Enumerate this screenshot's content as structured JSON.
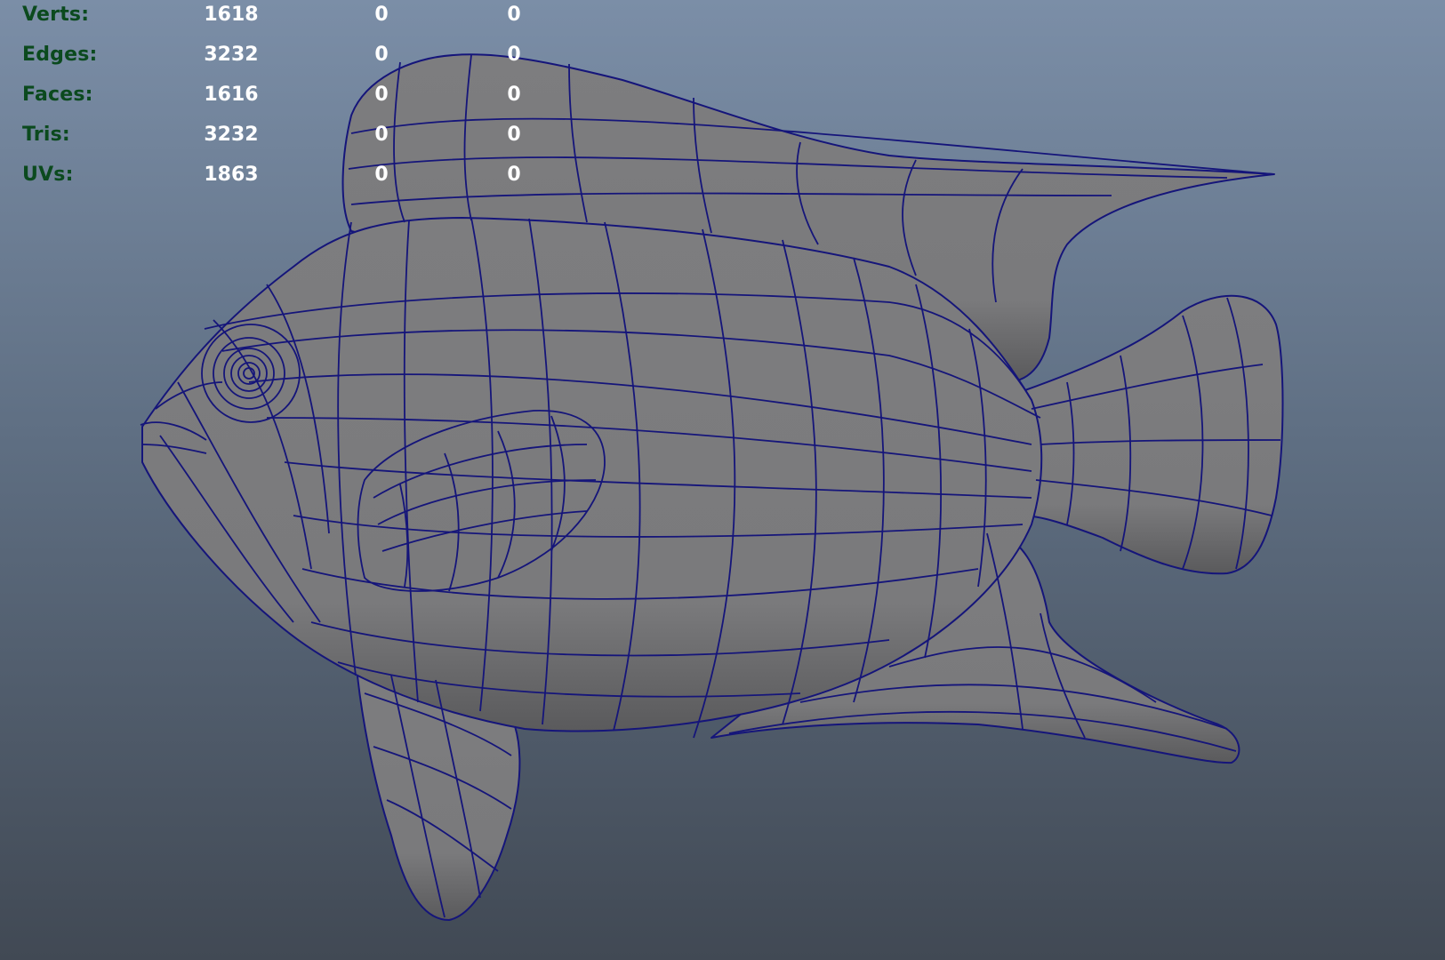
{
  "colors": {
    "background_top": "#7b8ea7",
    "background_bottom": "#414954",
    "label_green": "#0b4a1e",
    "value_white": "#ffffff",
    "mesh_fill": "#7c7c7e",
    "wire_blue": "#15157a"
  },
  "hud": {
    "rows": [
      {
        "label": "Verts:",
        "value": "1618",
        "col2": "0",
        "col3": "0"
      },
      {
        "label": "Edges:",
        "value": "3232",
        "col2": "0",
        "col3": "0"
      },
      {
        "label": "Faces:",
        "value": "1616",
        "col2": "0",
        "col3": "0"
      },
      {
        "label": "Tris:",
        "value": "3232",
        "col2": "0",
        "col3": "0"
      },
      {
        "label": "UVs:",
        "value": "1863",
        "col2": "0",
        "col3": "0"
      }
    ]
  }
}
